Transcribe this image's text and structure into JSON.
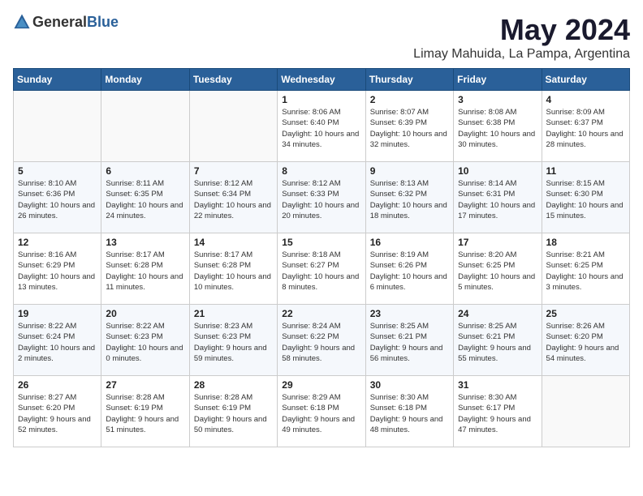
{
  "header": {
    "logo_general": "General",
    "logo_blue": "Blue",
    "month": "May 2024",
    "location": "Limay Mahuida, La Pampa, Argentina"
  },
  "days_of_week": [
    "Sunday",
    "Monday",
    "Tuesday",
    "Wednesday",
    "Thursday",
    "Friday",
    "Saturday"
  ],
  "weeks": [
    [
      {
        "day": "",
        "info": ""
      },
      {
        "day": "",
        "info": ""
      },
      {
        "day": "",
        "info": ""
      },
      {
        "day": "1",
        "info": "Sunrise: 8:06 AM\nSunset: 6:40 PM\nDaylight: 10 hours\nand 34 minutes."
      },
      {
        "day": "2",
        "info": "Sunrise: 8:07 AM\nSunset: 6:39 PM\nDaylight: 10 hours\nand 32 minutes."
      },
      {
        "day": "3",
        "info": "Sunrise: 8:08 AM\nSunset: 6:38 PM\nDaylight: 10 hours\nand 30 minutes."
      },
      {
        "day": "4",
        "info": "Sunrise: 8:09 AM\nSunset: 6:37 PM\nDaylight: 10 hours\nand 28 minutes."
      }
    ],
    [
      {
        "day": "5",
        "info": "Sunrise: 8:10 AM\nSunset: 6:36 PM\nDaylight: 10 hours\nand 26 minutes."
      },
      {
        "day": "6",
        "info": "Sunrise: 8:11 AM\nSunset: 6:35 PM\nDaylight: 10 hours\nand 24 minutes."
      },
      {
        "day": "7",
        "info": "Sunrise: 8:12 AM\nSunset: 6:34 PM\nDaylight: 10 hours\nand 22 minutes."
      },
      {
        "day": "8",
        "info": "Sunrise: 8:12 AM\nSunset: 6:33 PM\nDaylight: 10 hours\nand 20 minutes."
      },
      {
        "day": "9",
        "info": "Sunrise: 8:13 AM\nSunset: 6:32 PM\nDaylight: 10 hours\nand 18 minutes."
      },
      {
        "day": "10",
        "info": "Sunrise: 8:14 AM\nSunset: 6:31 PM\nDaylight: 10 hours\nand 17 minutes."
      },
      {
        "day": "11",
        "info": "Sunrise: 8:15 AM\nSunset: 6:30 PM\nDaylight: 10 hours\nand 15 minutes."
      }
    ],
    [
      {
        "day": "12",
        "info": "Sunrise: 8:16 AM\nSunset: 6:29 PM\nDaylight: 10 hours\nand 13 minutes."
      },
      {
        "day": "13",
        "info": "Sunrise: 8:17 AM\nSunset: 6:28 PM\nDaylight: 10 hours\nand 11 minutes."
      },
      {
        "day": "14",
        "info": "Sunrise: 8:17 AM\nSunset: 6:28 PM\nDaylight: 10 hours\nand 10 minutes."
      },
      {
        "day": "15",
        "info": "Sunrise: 8:18 AM\nSunset: 6:27 PM\nDaylight: 10 hours\nand 8 minutes."
      },
      {
        "day": "16",
        "info": "Sunrise: 8:19 AM\nSunset: 6:26 PM\nDaylight: 10 hours\nand 6 minutes."
      },
      {
        "day": "17",
        "info": "Sunrise: 8:20 AM\nSunset: 6:25 PM\nDaylight: 10 hours\nand 5 minutes."
      },
      {
        "day": "18",
        "info": "Sunrise: 8:21 AM\nSunset: 6:25 PM\nDaylight: 10 hours\nand 3 minutes."
      }
    ],
    [
      {
        "day": "19",
        "info": "Sunrise: 8:22 AM\nSunset: 6:24 PM\nDaylight: 10 hours\nand 2 minutes."
      },
      {
        "day": "20",
        "info": "Sunrise: 8:22 AM\nSunset: 6:23 PM\nDaylight: 10 hours\nand 0 minutes."
      },
      {
        "day": "21",
        "info": "Sunrise: 8:23 AM\nSunset: 6:23 PM\nDaylight: 9 hours\nand 59 minutes."
      },
      {
        "day": "22",
        "info": "Sunrise: 8:24 AM\nSunset: 6:22 PM\nDaylight: 9 hours\nand 58 minutes."
      },
      {
        "day": "23",
        "info": "Sunrise: 8:25 AM\nSunset: 6:21 PM\nDaylight: 9 hours\nand 56 minutes."
      },
      {
        "day": "24",
        "info": "Sunrise: 8:25 AM\nSunset: 6:21 PM\nDaylight: 9 hours\nand 55 minutes."
      },
      {
        "day": "25",
        "info": "Sunrise: 8:26 AM\nSunset: 6:20 PM\nDaylight: 9 hours\nand 54 minutes."
      }
    ],
    [
      {
        "day": "26",
        "info": "Sunrise: 8:27 AM\nSunset: 6:20 PM\nDaylight: 9 hours\nand 52 minutes."
      },
      {
        "day": "27",
        "info": "Sunrise: 8:28 AM\nSunset: 6:19 PM\nDaylight: 9 hours\nand 51 minutes."
      },
      {
        "day": "28",
        "info": "Sunrise: 8:28 AM\nSunset: 6:19 PM\nDaylight: 9 hours\nand 50 minutes."
      },
      {
        "day": "29",
        "info": "Sunrise: 8:29 AM\nSunset: 6:18 PM\nDaylight: 9 hours\nand 49 minutes."
      },
      {
        "day": "30",
        "info": "Sunrise: 8:30 AM\nSunset: 6:18 PM\nDaylight: 9 hours\nand 48 minutes."
      },
      {
        "day": "31",
        "info": "Sunrise: 8:30 AM\nSunset: 6:17 PM\nDaylight: 9 hours\nand 47 minutes."
      },
      {
        "day": "",
        "info": ""
      }
    ]
  ]
}
